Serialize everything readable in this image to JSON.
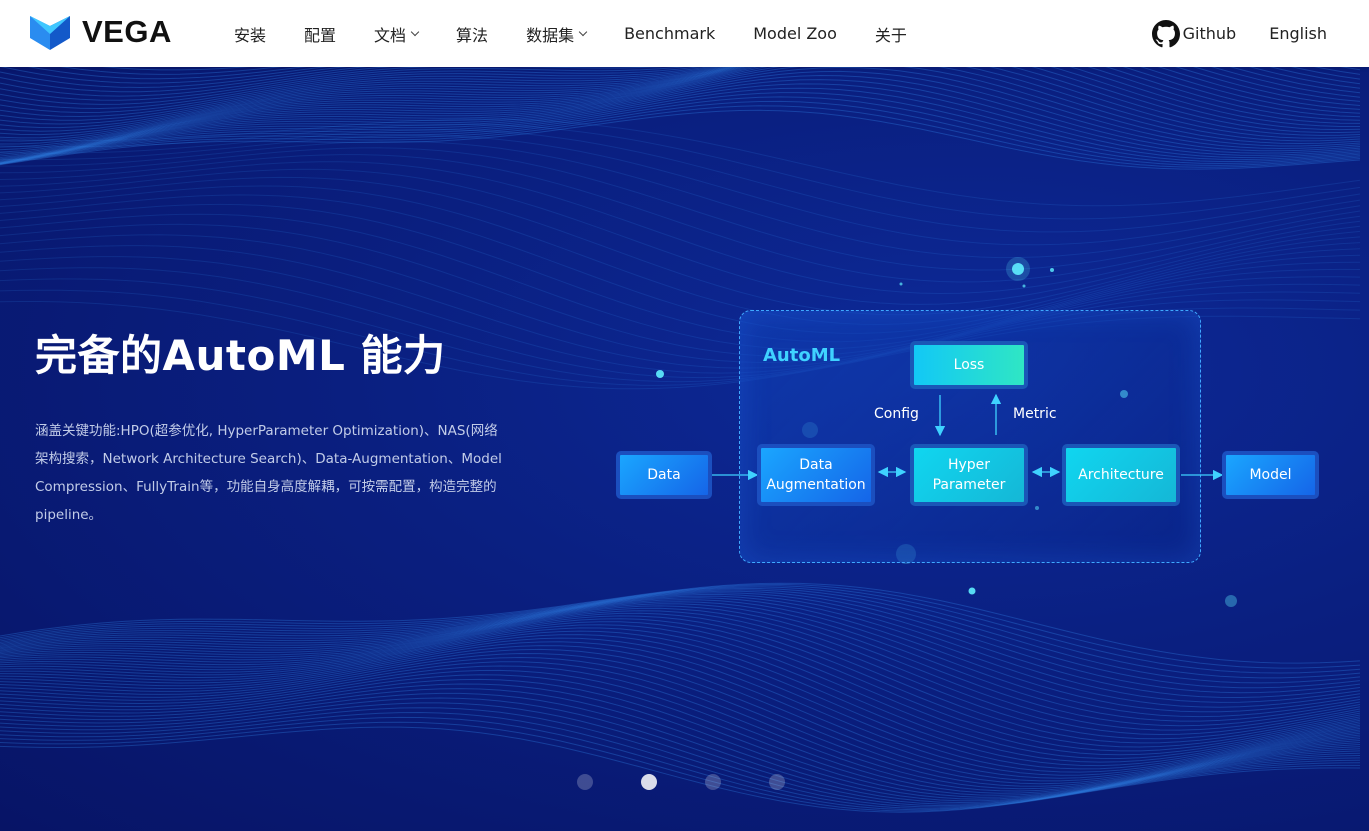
{
  "brand": {
    "name": "VEGA",
    "logo_icon": "vega-logo-icon"
  },
  "nav": {
    "items": [
      {
        "label": "安装",
        "has_dropdown": false
      },
      {
        "label": "配置",
        "has_dropdown": false
      },
      {
        "label": "文档",
        "has_dropdown": true
      },
      {
        "label": "算法",
        "has_dropdown": false
      },
      {
        "label": "数据集",
        "has_dropdown": true
      },
      {
        "label": "Benchmark",
        "has_dropdown": false
      },
      {
        "label": "Model Zoo",
        "has_dropdown": false
      },
      {
        "label": "关于",
        "has_dropdown": false
      }
    ],
    "github_label": "Github",
    "github_icon": "github-icon",
    "language_label": "English"
  },
  "hero": {
    "title": "完备的AutoML 能力",
    "description": "涵盖关键功能:HPO(超参优化, HyperParameter Optimization)、NAS(网络架构搜索，Network Architecture Search)、Data-Augmentation、Model Compression、FullyTrain等，功能自身高度解耦，可按需配置，构造完整的pipeline。"
  },
  "diagram": {
    "frame_label": "AutoML",
    "data": "Data",
    "data_augmentation_line1": "Data",
    "data_augmentation_line2": "Augmentation",
    "hyper_parameter_line1": "Hyper",
    "hyper_parameter_line2": "Parameter",
    "loss": "Loss",
    "architecture": "Architecture",
    "model": "Model",
    "config_label": "Config",
    "metric_label": "Metric"
  },
  "carousel": {
    "slide_count": 4,
    "active_index": 1
  },
  "colors": {
    "hero_bg": "#0a1f7a",
    "accent_cyan": "#3fd2ff",
    "box_blue": "#1565e8",
    "box_cyan": "#15b7d6"
  }
}
